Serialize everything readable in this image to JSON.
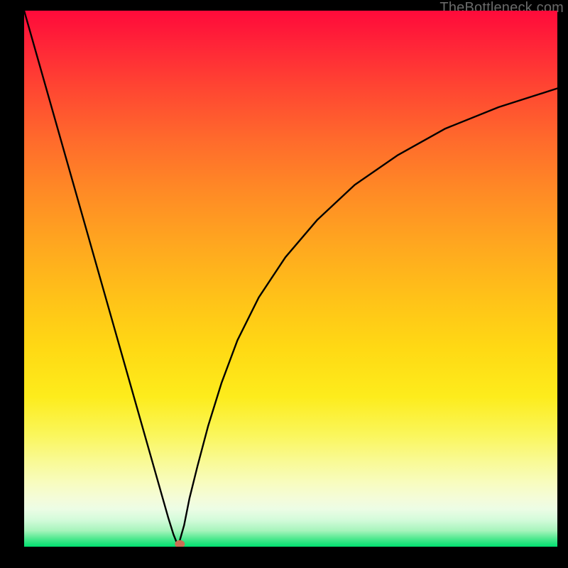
{
  "attribution": "TheBottleneck.com",
  "colors": {
    "background": "#000000",
    "gradient_top": "#ff0a3a",
    "gradient_bottom": "#00e070",
    "curve": "#000000",
    "marker": "#cc6e55"
  },
  "chart_data": {
    "type": "line",
    "title": "",
    "xlabel": "",
    "ylabel": "",
    "xlim": [
      0,
      100
    ],
    "ylim": [
      0,
      100
    ],
    "grid": false,
    "legend": false,
    "series": [
      {
        "name": "left-branch",
        "x": [
          0,
          4,
          8,
          12,
          16,
          20,
          24,
          26,
          27,
          28,
          28.8
        ],
        "y": [
          100,
          86,
          72,
          58,
          44,
          30,
          16,
          9,
          5.5,
          2.3,
          0.3
        ]
      },
      {
        "name": "right-branch",
        "x": [
          28.8,
          29.2,
          30,
          31,
          32.5,
          34.5,
          37,
          40,
          44,
          49,
          55,
          62,
          70,
          79,
          89,
          100
        ],
        "y": [
          0.3,
          1.2,
          4.0,
          9.0,
          15.0,
          22.5,
          30.5,
          38.5,
          46.5,
          54.0,
          61.0,
          67.5,
          73.0,
          78.0,
          82.0,
          85.5
        ]
      }
    ],
    "marker": {
      "x": 29.2,
      "y": 0.5,
      "shape": "oval"
    }
  }
}
